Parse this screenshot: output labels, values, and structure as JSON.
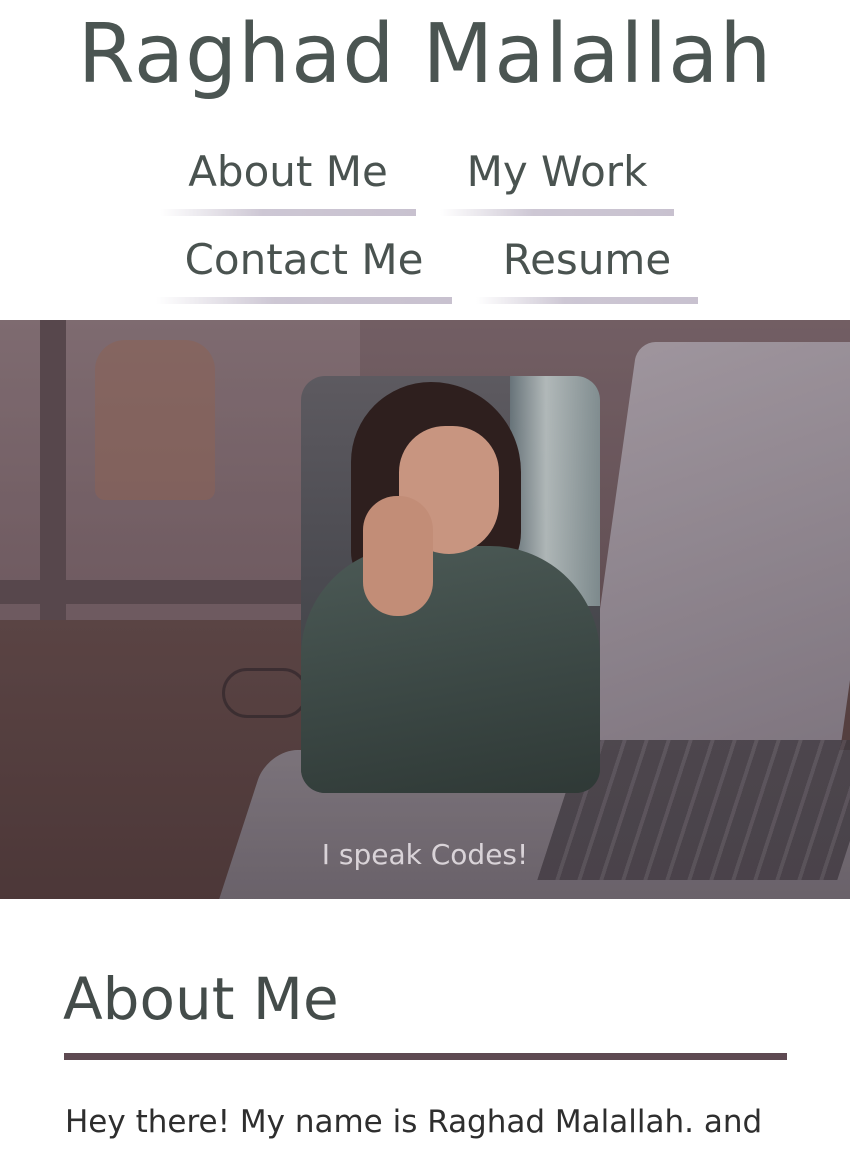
{
  "site": {
    "title": "Raghad Malallah"
  },
  "nav": {
    "items": [
      {
        "label": "About Me"
      },
      {
        "label": "My Work"
      },
      {
        "label": "Contact Me"
      },
      {
        "label": "Resume"
      }
    ]
  },
  "hero": {
    "tagline": "I speak Codes!"
  },
  "about": {
    "heading": "About Me",
    "intro": "Hey there! My name is Raghad Malallah. and"
  },
  "colors": {
    "title": "#4b5552",
    "accent_rule": "#5e4a52",
    "nav_underline": "#c8c1cf"
  }
}
